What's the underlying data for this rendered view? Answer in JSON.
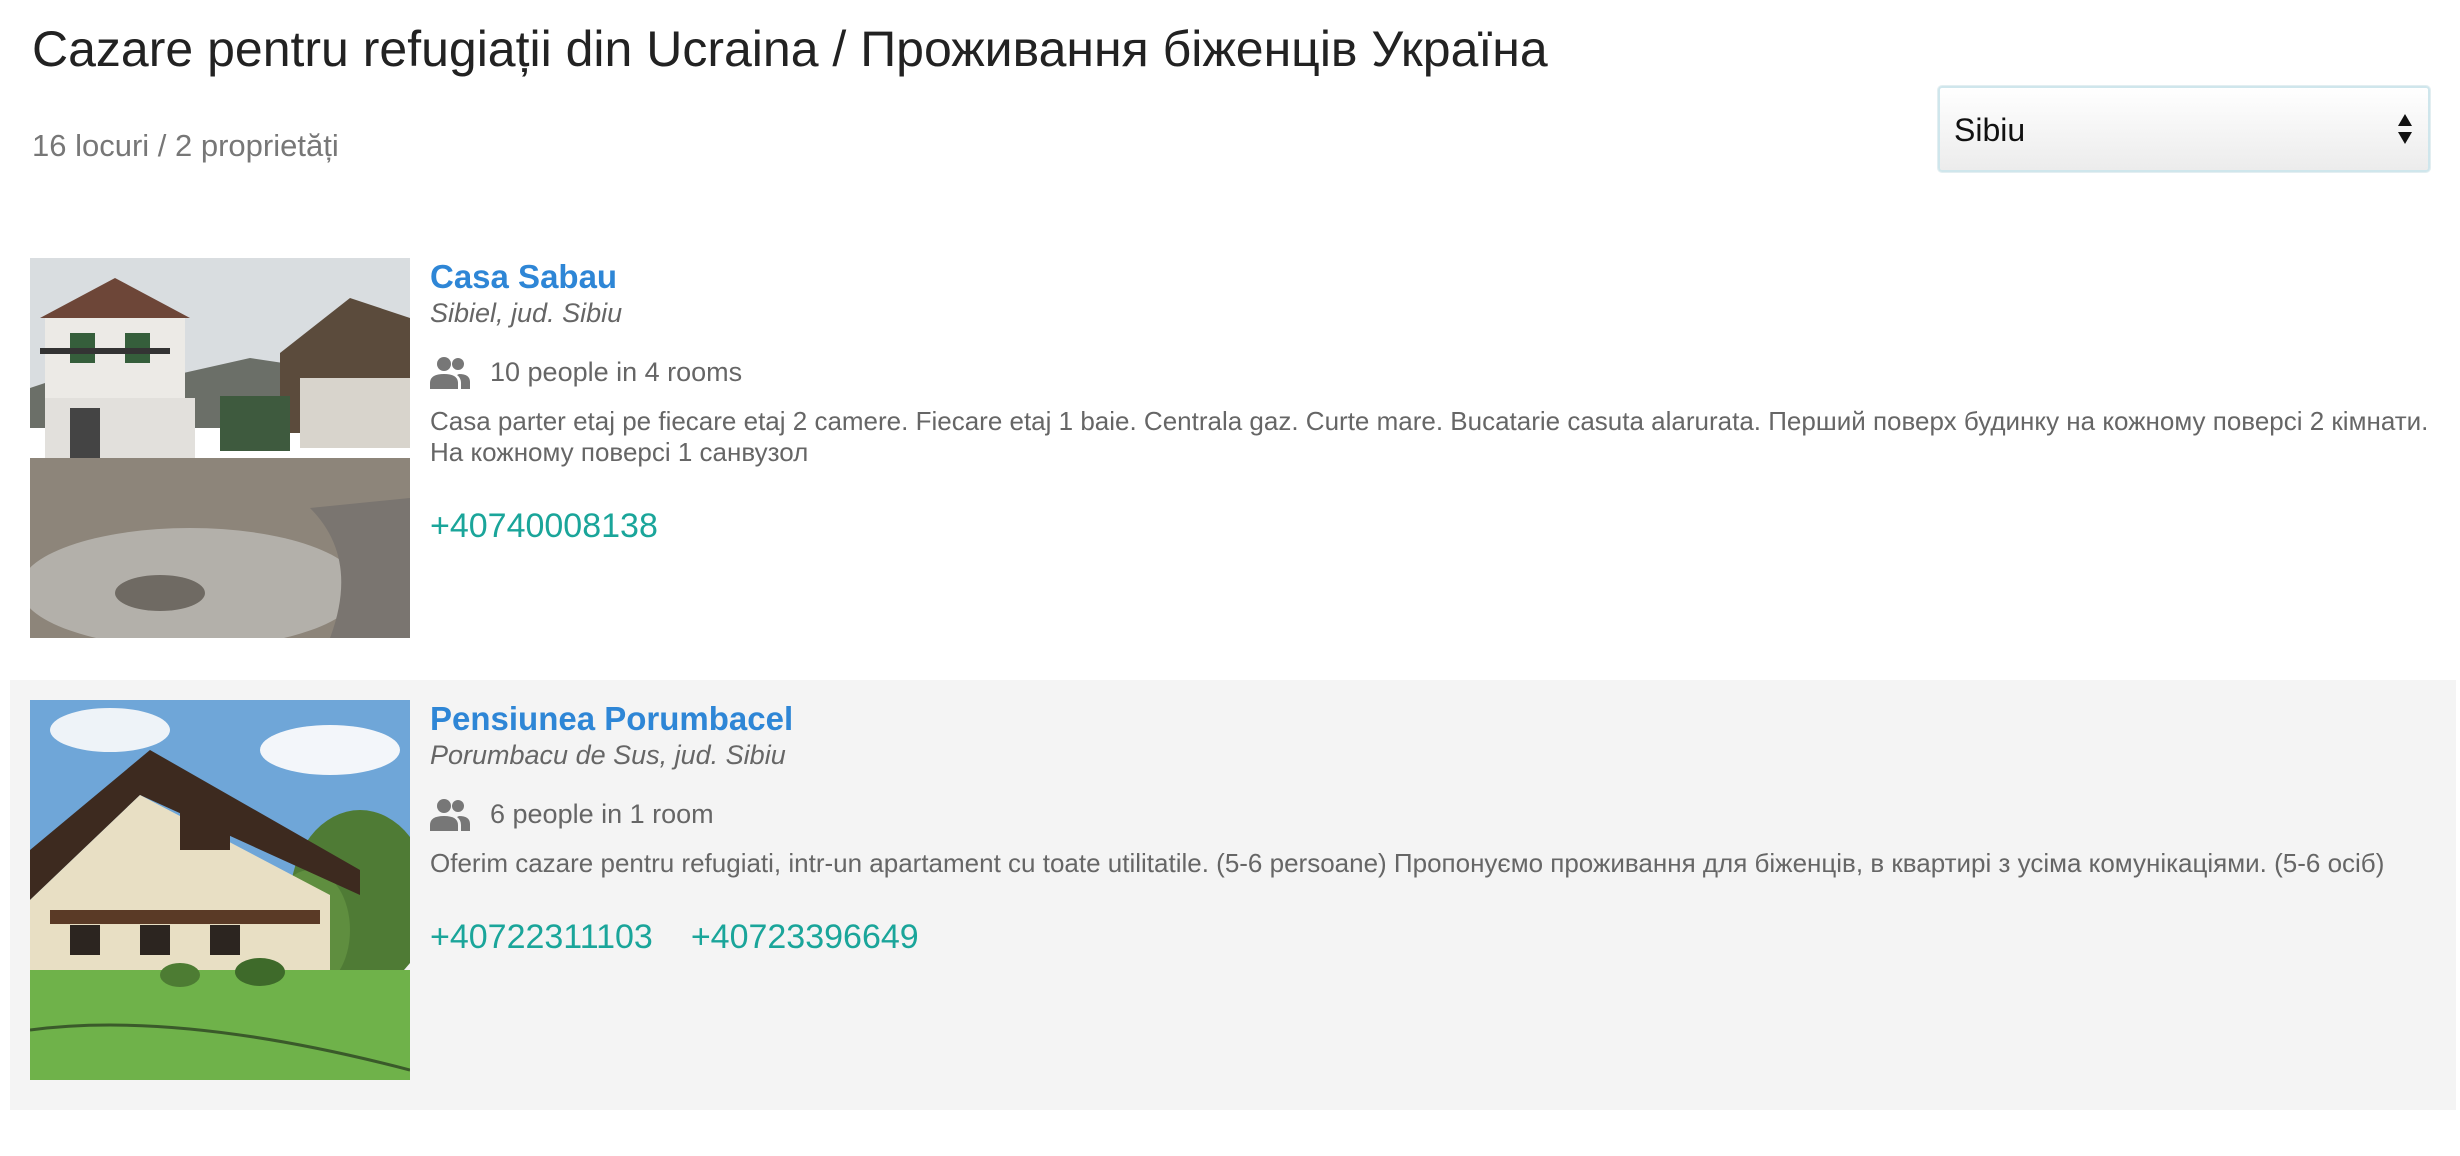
{
  "page": {
    "title": "Cazare pentru refugiații din Ucraina / Проживання біженців Україна",
    "summary": "16 locuri / 2 proprietăți"
  },
  "filter": {
    "city_selected": "Sibiu"
  },
  "listings": [
    {
      "name": "Casa Sabau",
      "location": "Sibiel, jud. Sibiu",
      "capacity": "10 people in 4 rooms",
      "description": "Casa parter etaj pe fiecare etaj 2 camere. Fiecare etaj 1 baie. Centrala gaz. Curte mare. Bucatarie casuta alarurata. Перший поверх будинку на кожному поверсі 2 кімнати. На кожному поверсі 1 санвузол",
      "phones": [
        "+40740008138"
      ],
      "photo": "white-house-courtyard-photo"
    },
    {
      "name": "Pensiunea Porumbacel",
      "location": "Porumbacu de Sus, jud. Sibiu",
      "capacity": "6 people in 1 room",
      "description": "Oferim cazare pentru refugiati, intr-un apartament cu toate utilitatile. (5-6 persoane) Пропонуємо проживання для біженців, в квартирі з усіма комунікаціями. (5-6 осіб)",
      "phones": [
        "+40722311103",
        "+40723396649"
      ],
      "photo": "chalet-lawn-photo"
    }
  ],
  "colors": {
    "link_blue": "#2e86d6",
    "phone_teal": "#1aa59a",
    "alt_row_bg": "#f4f4f4"
  },
  "icons": {
    "capacity": "people-icon",
    "select": "select-arrows-icon"
  }
}
